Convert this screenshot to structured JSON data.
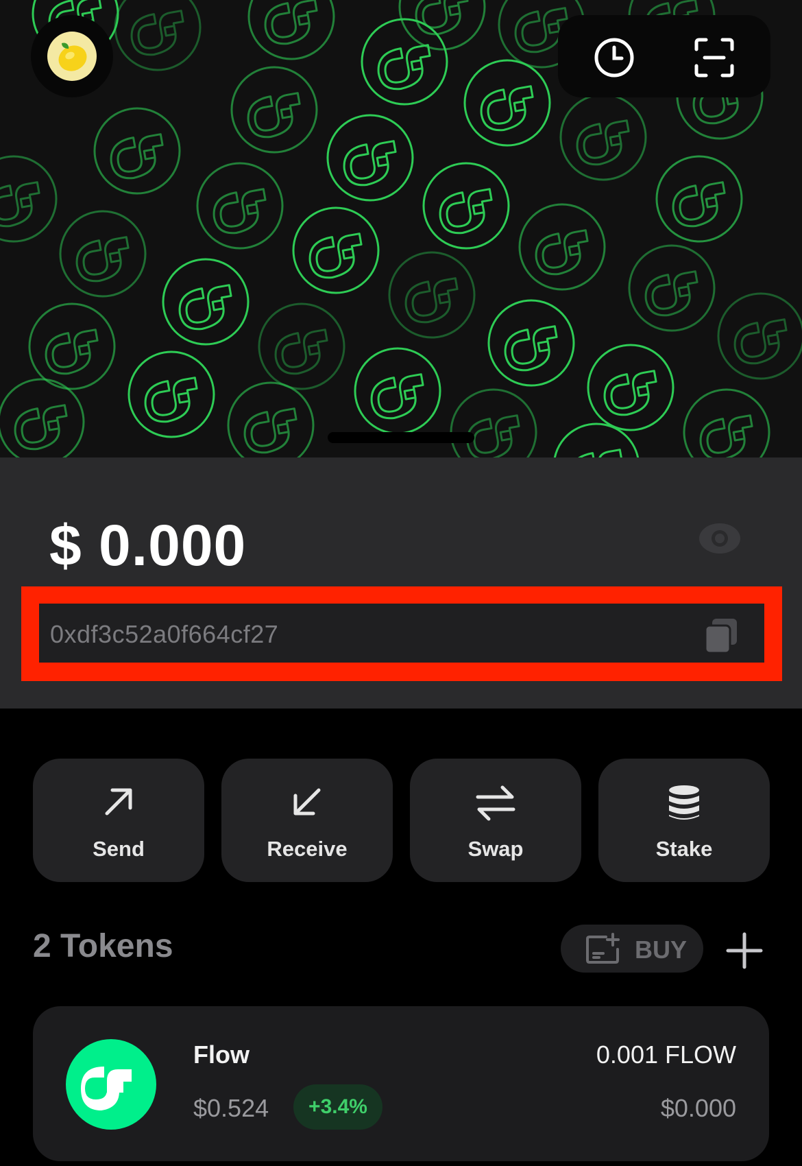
{
  "header": {
    "avatar_icon": "lemon-icon",
    "history_icon": "clock-icon",
    "scan_icon": "scan-icon",
    "accent_color": "#2ecc55"
  },
  "wallet": {
    "balance": "$ 0.000",
    "visibility_icon": "eye-icon",
    "address": "0xdf3c52a0f664cf27",
    "copy_icon": "copy-icon",
    "highlight_color": "#ff2200"
  },
  "actions": [
    {
      "label": "Send",
      "icon": "arrow-up-right-icon"
    },
    {
      "label": "Receive",
      "icon": "arrow-down-left-icon"
    },
    {
      "label": "Swap",
      "icon": "swap-arrows-icon"
    },
    {
      "label": "Stake",
      "icon": "coin-stack-icon"
    }
  ],
  "tokens": {
    "title": "2 Tokens",
    "buy_label": "BUY",
    "buy_icon": "buy-card-icon",
    "add_icon": "plus-icon",
    "items": [
      {
        "name": "Flow",
        "price": "$0.524",
        "change": "+3.4%",
        "amount": "0.001 FLOW",
        "value": "$0.000",
        "logo_icon": "flow-logo-icon",
        "logo_color": "#00ef8b",
        "change_color": "#3fcf6a"
      }
    ]
  }
}
